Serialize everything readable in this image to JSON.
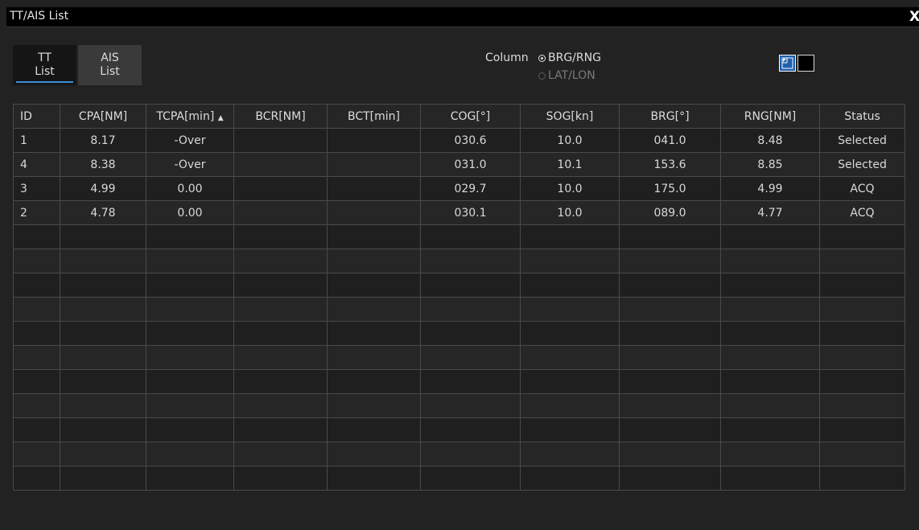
{
  "window": {
    "title": "TT/AIS List",
    "close_glyph": "X"
  },
  "tabs": [
    {
      "label": "TT\nList",
      "active": true
    },
    {
      "label": "AIS\nList",
      "active": false
    }
  ],
  "column_selector": {
    "label": "Column",
    "options": [
      {
        "label": "BRG/RNG",
        "selected": true
      },
      {
        "label": "LAT/LON",
        "selected": false
      }
    ]
  },
  "view_buttons": [
    {
      "icon": "corner-arrow-icon",
      "active": true
    },
    {
      "icon": "blank-view-icon",
      "active": false
    }
  ],
  "table": {
    "headers": [
      "ID",
      "CPA[NM]",
      "TCPA[min]",
      "BCR[NM]",
      "BCT[min]",
      "COG[°]",
      "SOG[kn]",
      "BRG[°]",
      "RNG[NM]",
      "Status"
    ],
    "sort_indicator": "▲",
    "rows": [
      [
        "1",
        "8.17",
        "-Over",
        "",
        "",
        "030.6",
        "10.0",
        "041.0",
        "8.48",
        "Selected"
      ],
      [
        "4",
        "8.38",
        "-Over",
        "",
        "",
        "031.0",
        "10.1",
        "153.6",
        "8.85",
        "Selected"
      ],
      [
        "3",
        "4.99",
        "0.00",
        "",
        "",
        "029.7",
        "10.0",
        "175.0",
        "4.99",
        "ACQ"
      ],
      [
        "2",
        "4.78",
        "0.00",
        "",
        "",
        "030.1",
        "10.0",
        "089.0",
        "4.77",
        "ACQ"
      ]
    ],
    "empty_rows": 11
  },
  "colors": {
    "accent": "#1f5fae",
    "tab_underline": "#3b8fd8",
    "background": "#222222"
  }
}
